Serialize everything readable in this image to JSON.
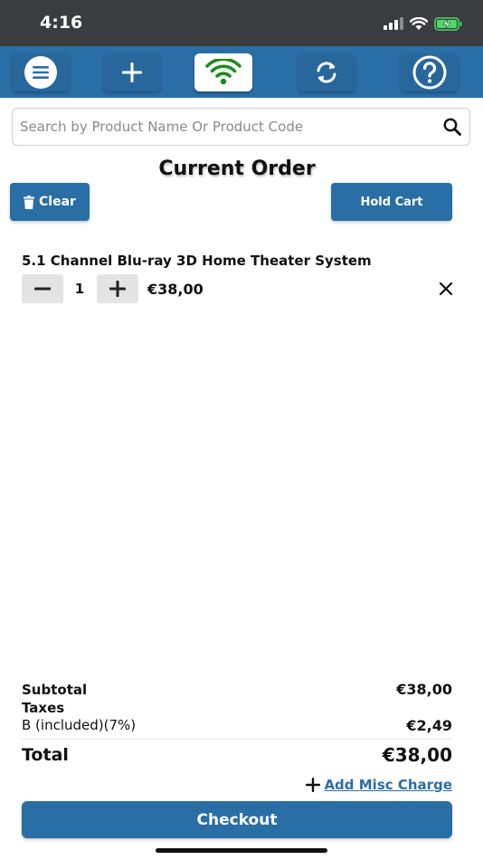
{
  "status_bar": {
    "time": "4:16"
  },
  "toolbar": {
    "buttons": [
      {
        "icon": "menu-icon"
      },
      {
        "icon": "plus-icon"
      },
      {
        "icon": "wifi-icon",
        "active": true
      },
      {
        "icon": "sync-icon"
      },
      {
        "icon": "help-icon"
      }
    ]
  },
  "search": {
    "placeholder": "Search by Product Name Or Product Code",
    "value": ""
  },
  "order": {
    "title": "Current Order",
    "clear_label": "Clear",
    "hold_label": "Hold Cart",
    "items": [
      {
        "name": "5.1 Channel Blu-ray 3D Home Theater System",
        "quantity": "1",
        "price": "€38,00"
      }
    ]
  },
  "summary": {
    "subtotal_label": "Subtotal",
    "subtotal_value": "€38,00",
    "taxes_label": "Taxes",
    "tax_line_label": "B (included)(7%)",
    "tax_line_value": "€2,49",
    "total_label": "Total",
    "total_value": "€38,00",
    "misc_label": "Add Misc Charge",
    "checkout_label": "Checkout"
  },
  "colors": {
    "primary": "#2a6ea6",
    "status_bar": "#3a3c3f",
    "wifi_green": "#1e8a1e"
  }
}
